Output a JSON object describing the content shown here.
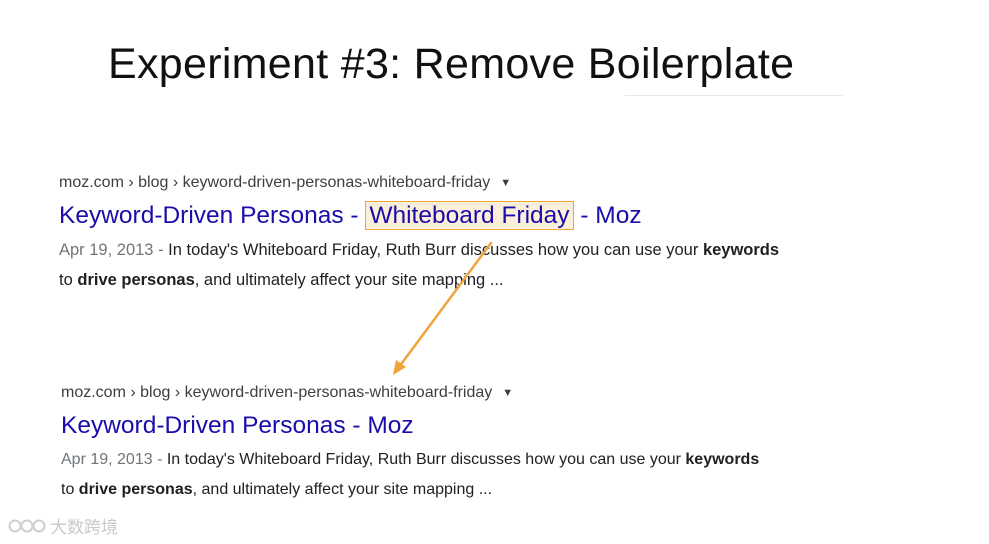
{
  "slide": {
    "title": "Experiment #3: Remove Boilerplate"
  },
  "result_before": {
    "breadcrumb": "moz.com › blog › keyword-driven-personas-whiteboard-friday",
    "title_start": "Keyword-Driven Personas - ",
    "title_highlight": "Whiteboard Friday",
    "title_end": " - Moz",
    "date": "Apr 19, 2013",
    "sep": " - ",
    "snippet_1a": "In today's Whiteboard Friday, Ruth Burr discusses how you can use your ",
    "snippet_1b": "keywords",
    "snippet_2a": "to ",
    "snippet_2b": "drive personas",
    "snippet_2c": ", and ultimately affect your site mapping ..."
  },
  "result_after": {
    "breadcrumb": "moz.com › blog › keyword-driven-personas-whiteboard-friday",
    "title": "Keyword-Driven Personas - Moz",
    "date": "Apr 19, 2013",
    "sep": " - ",
    "snippet_1a": "In today's Whiteboard Friday, Ruth Burr discusses how you can use your ",
    "snippet_1b": "keywords",
    "snippet_2a": "to ",
    "snippet_2b": "drive personas",
    "snippet_2c": ", and ultimately affect your site mapping ..."
  },
  "colors": {
    "link": "#1a0dab",
    "highlight_border": "#f0a53a",
    "highlight_fill": "#fcefd9",
    "arrow": "#f2a33c"
  },
  "icons": {
    "dropdown": "caret-down-icon",
    "arrow": "arrow-icon"
  },
  "watermark": {
    "text": "大数跨境"
  }
}
